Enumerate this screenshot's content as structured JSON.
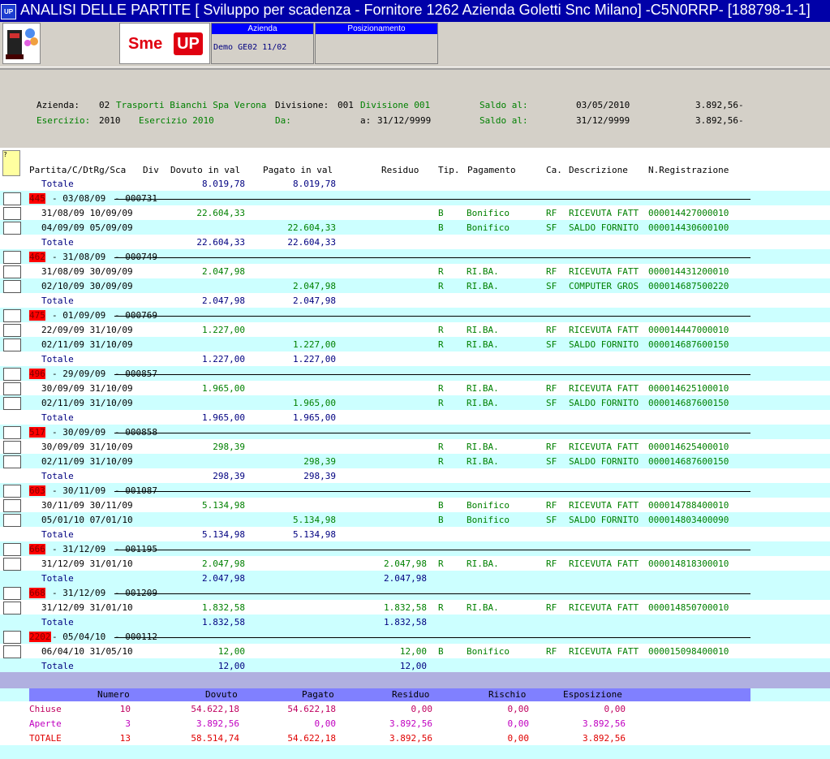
{
  "window": {
    "icon_label": "UP",
    "title": "ANALISI DELLE PARTITE [ Sviluppo per scadenza  - Fornitore 1262 Azienda Goletti Snc Milano] -C5N0RRP- [188798-1-1]"
  },
  "toolbar": {
    "brand_sme": "Sme",
    "brand_up": "UP",
    "azienda_header": "Azienda",
    "azienda_value": "Demo GE02 11/02",
    "posizionamento_header": "Posizionamento",
    "posizionamento_value": ""
  },
  "info": {
    "azienda_label": "Azienda:",
    "azienda_code": "02",
    "azienda_name": "Trasporti Bianchi Spa Verona",
    "divisione_label": "Divisione:",
    "divisione_code": "001",
    "divisione_name": "Divisione 001",
    "saldo1_label": "Saldo al:",
    "saldo1_date": "03/05/2010",
    "saldo1_value": "3.892,56-",
    "esercizio_label": "Esercizio:",
    "esercizio_code": "2010",
    "esercizio_name": "Esercizio 2010",
    "da_label": "Da:",
    "a_label": "a:",
    "a_value": "31/12/9999",
    "saldo2_label": "Saldo al:",
    "saldo2_date": "31/12/9999",
    "saldo2_value": "3.892,56-"
  },
  "grid": {
    "qmark": "?",
    "headers": [
      "Partita/C/DtRg/Sca",
      "Div",
      "Dovuto in val",
      "Pagato in val",
      "Residuo",
      "Tip.",
      "Pagamento",
      "Ca.",
      "Descrizione",
      "N.Registrazione"
    ],
    "initial_total": {
      "label": "Totale",
      "dovuto": "8.019,78",
      "pagato": "8.019,78",
      "residuo": ""
    },
    "groups": [
      {
        "num": "445",
        "date": "- 03/08/09",
        "ref": "- 000731",
        "rows": [
          {
            "dates": "31/08/09 10/09/09",
            "dovuto": "22.604,33",
            "pagato": "",
            "residuo": "",
            "tip": "B",
            "pag": "Bonifico",
            "ca": "RF",
            "desc": "RICEVUTA FATT",
            "nreg": "000014427000010"
          },
          {
            "dates": "04/09/09 05/09/09",
            "dovuto": "",
            "pagato": "22.604,33",
            "residuo": "",
            "tip": "B",
            "pag": "Bonifico",
            "ca": "SF",
            "desc": "SALDO FORNITO",
            "nreg": "000014430600100"
          }
        ],
        "total": {
          "label": "Totale",
          "dovuto": "22.604,33",
          "pagato": "22.604,33",
          "residuo": ""
        }
      },
      {
        "num": "462",
        "date": "- 31/08/09",
        "ref": "- 000749",
        "rows": [
          {
            "dates": "31/08/09 30/09/09",
            "dovuto": "2.047,98",
            "pagato": "",
            "residuo": "",
            "tip": "R",
            "pag": "RI.BA.",
            "ca": "RF",
            "desc": "RICEVUTA FATT",
            "nreg": "000014431200010"
          },
          {
            "dates": "02/10/09 30/09/09",
            "dovuto": "",
            "pagato": "2.047,98",
            "residuo": "",
            "tip": "R",
            "pag": "RI.BA.",
            "ca": "SF",
            "desc": "COMPUTER GROS",
            "nreg": "000014687500220"
          }
        ],
        "total": {
          "label": "Totale",
          "dovuto": "2.047,98",
          "pagato": "2.047,98",
          "residuo": ""
        }
      },
      {
        "num": "475",
        "date": "- 01/09/09",
        "ref": "- 000769",
        "rows": [
          {
            "dates": "22/09/09 31/10/09",
            "dovuto": "1.227,00",
            "pagato": "",
            "residuo": "",
            "tip": "R",
            "pag": "RI.BA.",
            "ca": "RF",
            "desc": "RICEVUTA FATT",
            "nreg": "000014447000010"
          },
          {
            "dates": "02/11/09 31/10/09",
            "dovuto": "",
            "pagato": "1.227,00",
            "residuo": "",
            "tip": "R",
            "pag": "RI.BA.",
            "ca": "SF",
            "desc": "SALDO FORNITO",
            "nreg": "000014687600150"
          }
        ],
        "total": {
          "label": "Totale",
          "dovuto": "1.227,00",
          "pagato": "1.227,00",
          "residuo": ""
        }
      },
      {
        "num": "496",
        "date": "- 29/09/09",
        "ref": "- 000857",
        "rows": [
          {
            "dates": "30/09/09 31/10/09",
            "dovuto": "1.965,00",
            "pagato": "",
            "residuo": "",
            "tip": "R",
            "pag": "RI.BA.",
            "ca": "RF",
            "desc": "RICEVUTA FATT",
            "nreg": "000014625100010"
          },
          {
            "dates": "02/11/09 31/10/09",
            "dovuto": "",
            "pagato": "1.965,00",
            "residuo": "",
            "tip": "R",
            "pag": "RI.BA.",
            "ca": "SF",
            "desc": "SALDO FORNITO",
            "nreg": "000014687600150"
          }
        ],
        "total": {
          "label": "Totale",
          "dovuto": "1.965,00",
          "pagato": "1.965,00",
          "residuo": ""
        }
      },
      {
        "num": "517",
        "date": "- 30/09/09",
        "ref": "- 000858",
        "rows": [
          {
            "dates": "30/09/09 31/10/09",
            "dovuto": "298,39",
            "pagato": "",
            "residuo": "",
            "tip": "R",
            "pag": "RI.BA.",
            "ca": "RF",
            "desc": "RICEVUTA FATT",
            "nreg": "000014625400010"
          },
          {
            "dates": "02/11/09 31/10/09",
            "dovuto": "",
            "pagato": "298,39",
            "residuo": "",
            "tip": "R",
            "pag": "RI.BA.",
            "ca": "SF",
            "desc": "SALDO FORNITO",
            "nreg": "000014687600150"
          }
        ],
        "total": {
          "label": "Totale",
          "dovuto": "298,39",
          "pagato": "298,39",
          "residuo": ""
        }
      },
      {
        "num": "603",
        "date": "- 30/11/09",
        "ref": "- 001087",
        "rows": [
          {
            "dates": "30/11/09 30/11/09",
            "dovuto": "5.134,98",
            "pagato": "",
            "residuo": "",
            "tip": "B",
            "pag": "Bonifico",
            "ca": "RF",
            "desc": "RICEVUTA FATT",
            "nreg": "000014788400010"
          },
          {
            "dates": "05/01/10 07/01/10",
            "dovuto": "",
            "pagato": "5.134,98",
            "residuo": "",
            "tip": "B",
            "pag": "Bonifico",
            "ca": "SF",
            "desc": "SALDO FORNITO",
            "nreg": "000014803400090"
          }
        ],
        "total": {
          "label": "Totale",
          "dovuto": "5.134,98",
          "pagato": "5.134,98",
          "residuo": ""
        }
      },
      {
        "num": "666",
        "date": "- 31/12/09",
        "ref": "- 001195",
        "rows": [
          {
            "dates": "31/12/09 31/01/10",
            "dovuto": "2.047,98",
            "pagato": "",
            "residuo": "2.047,98",
            "tip": "R",
            "pag": "RI.BA.",
            "ca": "RF",
            "desc": "RICEVUTA FATT",
            "nreg": "000014818300010"
          }
        ],
        "total": {
          "label": "Totale",
          "dovuto": "2.047,98",
          "pagato": "",
          "residuo": "2.047,98"
        }
      },
      {
        "num": "668",
        "date": "- 31/12/09",
        "ref": "- 001209",
        "rows": [
          {
            "dates": "31/12/09 31/01/10",
            "dovuto": "1.832,58",
            "pagato": "",
            "residuo": "1.832,58",
            "tip": "R",
            "pag": "RI.BA.",
            "ca": "RF",
            "desc": "RICEVUTA FATT",
            "nreg": "000014850700010"
          }
        ],
        "total": {
          "label": "Totale",
          "dovuto": "1.832,58",
          "pagato": "",
          "residuo": "1.832,58"
        }
      },
      {
        "num": "2202",
        "date": "- 05/04/10",
        "ref": "- 000112",
        "rows": [
          {
            "dates": "06/04/10 31/05/10",
            "dovuto": "12,00",
            "pagato": "",
            "residuo": "12,00",
            "tip": "B",
            "pag": "Bonifico",
            "ca": "RF",
            "desc": "RICEVUTA FATT",
            "nreg": "000015098400010"
          }
        ],
        "total": {
          "label": "Totale",
          "dovuto": "12,00",
          "pagato": "",
          "residuo": "12,00"
        }
      }
    ]
  },
  "summary": {
    "headers": [
      "Numero",
      "Dovuto",
      "Pagato",
      "Residuo",
      "Rischio",
      "Esposizione"
    ],
    "rows": [
      {
        "label": "Chiuse",
        "numero": "10",
        "dovuto": "54.622,18",
        "pagato": "54.622,18",
        "residuo": "0,00",
        "rischio": "0,00",
        "esposizione": "0,00",
        "color": "#c00060"
      },
      {
        "label": "Aperte",
        "numero": "3",
        "dovuto": "3.892,56",
        "pagato": "0,00",
        "residuo": "3.892,56",
        "rischio": "0,00",
        "esposizione": "3.892,56",
        "color": "#c000c0"
      },
      {
        "label": "TOTALE",
        "numero": "13",
        "dovuto": "58.514,74",
        "pagato": "54.622,18",
        "residuo": "3.892,56",
        "rischio": "0,00",
        "esposizione": "3.892,56",
        "color": "#e00000"
      }
    ]
  },
  "colors": {
    "titlebar": "#0000a8",
    "tag_red": "#ff0000",
    "row_cyan": "#ccffff",
    "detail_green": "#008000",
    "total_blue": "#000080",
    "summary_header": "#8080ff"
  }
}
